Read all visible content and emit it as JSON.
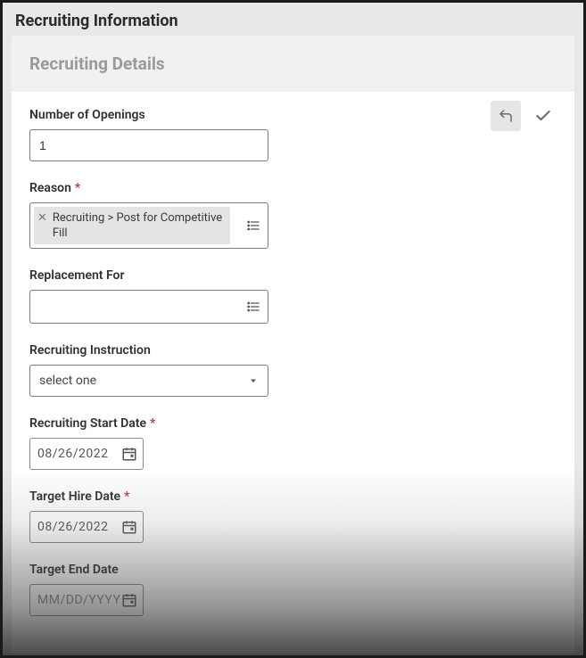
{
  "header": {
    "title": "Recruiting Information"
  },
  "section": {
    "title": "Recruiting Details"
  },
  "actions": {
    "undo": "undo",
    "approve": "approve"
  },
  "fields": {
    "openings": {
      "label": "Number of Openings",
      "value": "1"
    },
    "reason": {
      "label": "Reason",
      "chip": "Recruiting > Post for Competitive Fill"
    },
    "replacement": {
      "label": "Replacement For",
      "value": ""
    },
    "instruction": {
      "label": "Recruiting Instruction",
      "placeholder": "select one"
    },
    "startDate": {
      "label": "Recruiting Start Date",
      "value": "08/26/2022"
    },
    "hireDate": {
      "label": "Target Hire Date",
      "value": "08/26/2022"
    },
    "endDate": {
      "label": "Target End Date",
      "placeholder": "MM/DD/YYYY"
    }
  }
}
